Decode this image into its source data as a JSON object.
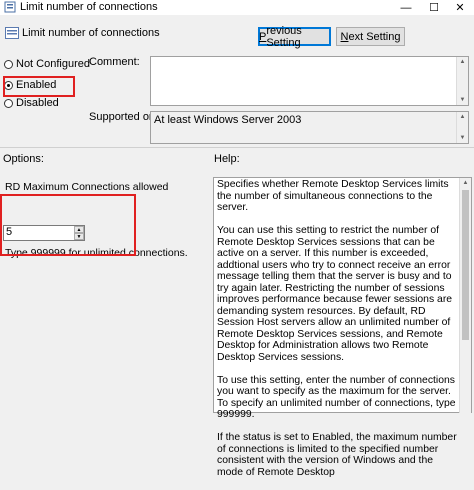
{
  "window": {
    "title": "Limit number of connections",
    "minimize": "—",
    "maximize": "☐",
    "close": "✕"
  },
  "header": {
    "title": "Limit number of connections",
    "prev_label_u": "P",
    "prev_label_rest": "revious Setting",
    "next_label_u": "N",
    "next_label_rest": "ext Setting"
  },
  "state": {
    "options": [
      "Not Configured",
      "Enabled",
      "Disabled"
    ],
    "selected": "Enabled",
    "not_configured_u": "C",
    "enabled_u": "E",
    "disabled_u": "D"
  },
  "comment": {
    "label": "Comment:",
    "value": ""
  },
  "supported": {
    "label": "Supported on:",
    "value": "At least Windows Server 2003"
  },
  "options_section": {
    "label": "Options:",
    "field_label": "RD Maximum Connections allowed",
    "value": "5",
    "hint": "Type 999999 for unlimited connections."
  },
  "help": {
    "label": "Help:",
    "paragraphs": [
      "Specifies whether Remote Desktop Services limits the number of simultaneous connections to the server.",
      "You can use this setting to restrict the number of Remote Desktop Services sessions that can be active on a server. If this number is exceeded, addtional users who try to connect receive an error message telling them that the server is busy and to try again later. Restricting the number of sessions improves performance because fewer sessions are demanding system resources. By default, RD Session Host servers allow an unlimited number of Remote Desktop Services sessions, and Remote Desktop for Administration allows two Remote Desktop Services sessions.",
      "To use this setting, enter the number of connections you want to specify as the maximum for the server. To specify an unlimited number of connections, type 999999.",
      "If the status is set to Enabled, the maximum number of connections is limited to the specified number consistent with the version of Windows and the mode of Remote Desktop"
    ]
  },
  "colors": {
    "accent": "#0078d7",
    "highlight": "#e02020"
  }
}
